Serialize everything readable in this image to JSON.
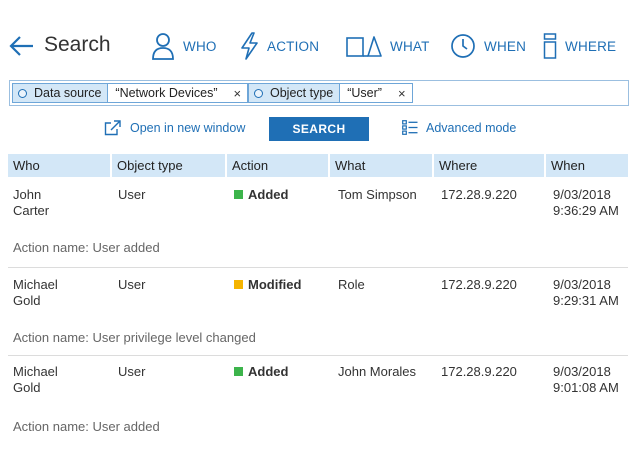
{
  "header": {
    "title": "Search",
    "nav": [
      {
        "label": "WHO",
        "icon": "person-icon"
      },
      {
        "label": "ACTION",
        "icon": "lightning-icon"
      },
      {
        "label": "WHAT",
        "icon": "shapes-icon"
      },
      {
        "label": "WHEN",
        "icon": "clock-icon"
      },
      {
        "label": "WHERE",
        "icon": "building-icon"
      }
    ]
  },
  "filters": [
    {
      "key": "Data source",
      "value": "“Network Devices”",
      "remove": "×"
    },
    {
      "key": "Object type",
      "value": "“User”",
      "remove": "×"
    }
  ],
  "actions": {
    "open_new": "Open in new window",
    "search": "SEARCH",
    "advanced": "Advanced mode"
  },
  "table": {
    "columns": [
      "Who",
      "Object type",
      "Action",
      "What",
      "Where",
      "When"
    ],
    "rows": [
      {
        "who": [
          "John",
          "Carter"
        ],
        "object_type": "User",
        "action": "Added",
        "action_color": "#3cb44b",
        "what": "Tom Simpson",
        "where": "172.28.9.220",
        "when": [
          "9/03/2018",
          "9:36:29 AM"
        ],
        "action_name": "Action name: User added"
      },
      {
        "who": [
          "Michael",
          "Gold"
        ],
        "object_type": "User",
        "action": "Modified",
        "action_color": "#f5b400",
        "what": "Role",
        "where": "172.28.9.220",
        "when": [
          "9/03/2018",
          "9:29:31 AM"
        ],
        "action_name": "Action name: User privilege level changed"
      },
      {
        "who": [
          "Michael",
          "Gold"
        ],
        "object_type": "User",
        "action": "Added",
        "action_color": "#3cb44b",
        "what": "John Morales",
        "where": "172.28.9.220",
        "when": [
          "9/03/2018",
          "9:01:08 AM"
        ],
        "action_name": "Action name: User added"
      }
    ]
  },
  "colors": {
    "accent": "#1f6fb5",
    "header_bg": "#d3e7f7",
    "added": "#3cb44b",
    "modified": "#f5b400"
  }
}
